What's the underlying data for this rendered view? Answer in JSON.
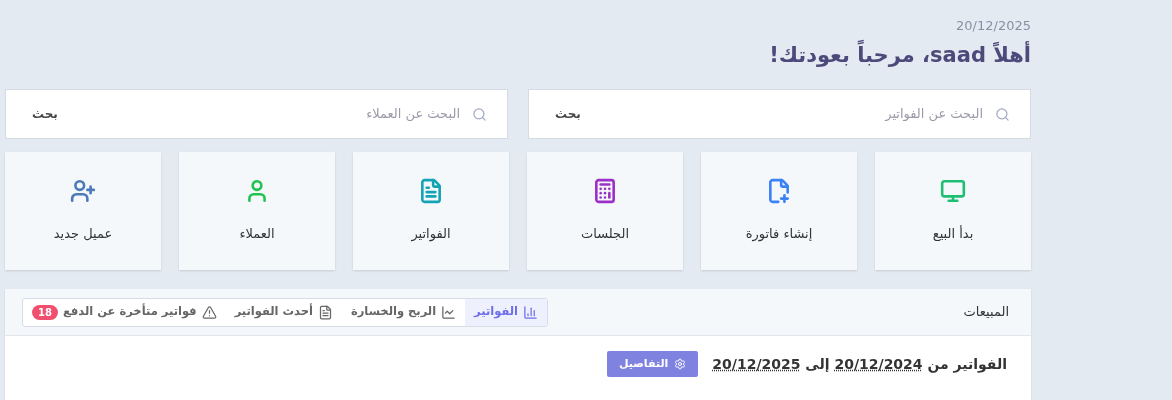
{
  "header": {
    "date": "20/12/2025",
    "greeting": "أهلاً saad، مرحباً بعودتك!"
  },
  "searches": [
    {
      "placeholder": "البحث عن الفواتير",
      "button": "بحث"
    },
    {
      "placeholder": "البحث عن العملاء",
      "button": "بحث"
    }
  ],
  "tiles": [
    {
      "kind": "pos",
      "label": "بدأ البيع",
      "color": "#1dbf73"
    },
    {
      "kind": "new-invoice",
      "label": "إنشاء فاتورة",
      "color": "#3b82f6"
    },
    {
      "kind": "sessions",
      "label": "الجلسات",
      "color": "#9b30c8"
    },
    {
      "kind": "invoices",
      "label": "الفواتير",
      "color": "#13a3b5"
    },
    {
      "kind": "customers",
      "label": "العملاء",
      "color": "#1fc34e"
    },
    {
      "kind": "new-customer",
      "label": "عميل جديد",
      "color": "#4a7ab8"
    }
  ],
  "sales": {
    "title": "المبيعات",
    "tabs": [
      {
        "kind": "bars",
        "label": "الفواتير",
        "selected": true
      },
      {
        "kind": "line",
        "label": "الربح والخسارة",
        "selected": false
      },
      {
        "kind": "file",
        "label": "أحدث الفواتير",
        "selected": false
      },
      {
        "kind": "warning",
        "label": "فواتير متأخرة عن الدفع",
        "selected": false,
        "badge": "18"
      }
    ],
    "range": {
      "prefix": "الفواتير من",
      "from": "20/12/2024",
      "connector": "إلى",
      "to": "20/12/2025"
    },
    "details_button": "التفاصيل"
  }
}
